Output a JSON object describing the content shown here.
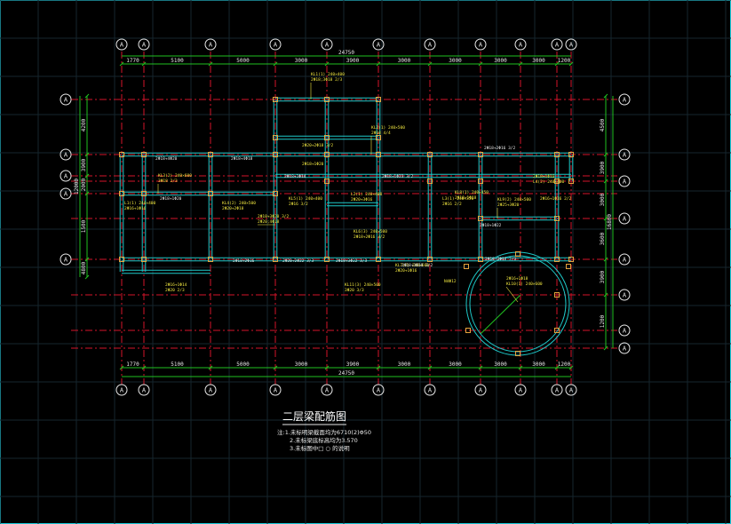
{
  "drawing": {
    "title": "二层梁配筋图",
    "notes": [
      "注:1.未标明梁截面均为6710(2)Φ50",
      "2.未标梁底标高均为3.570",
      "3.未标图中□ ○ 的说明"
    ]
  },
  "axes": {
    "vertical_labels": [
      "A",
      "A",
      "A",
      "A",
      "A",
      "A",
      "A",
      "A",
      "A",
      "A",
      "A"
    ],
    "horizontal_labels_left": [
      "A",
      "A",
      "A",
      "A",
      "A"
    ],
    "horizontal_labels_right": [
      "A",
      "A",
      "A",
      "A",
      "A",
      "A",
      "A",
      "A"
    ]
  },
  "dimensions": {
    "top_overall": "24750",
    "top_segments": [
      "1770",
      "5100",
      "5000",
      "3000",
      "3900",
      "3000",
      "3000",
      "3000",
      "3000",
      "1200"
    ],
    "bottom_overall": "24750",
    "bottom_segments": [
      "1770",
      "5100",
      "5000",
      "3000",
      "3900",
      "3000",
      "3000",
      "3000",
      "3000",
      "1200"
    ],
    "left_segments": [
      "4200",
      "3900",
      "2000",
      "1500",
      "4800",
      "1800"
    ],
    "left_overall": "12000",
    "right_segments": [
      "4500",
      "3900",
      "3000",
      "3600",
      "3900",
      "1200"
    ],
    "right_overall": "16800"
  },
  "beam_labels": [
    "KL1(1) 240×400",
    "2Φ18;3Φ18 2/3",
    "KL2(1) 240×500",
    "2Φ18 4/4",
    "2Φ20+2Φ18 3/2",
    "2Φ18+1Φ20",
    "KL3(2) 240×600",
    "3Φ18 2/3",
    "L1(1) 240×400",
    "2Φ16+1Φ16",
    "KL4(2) 240×500",
    "2Φ20+2Φ18",
    "2Φ18+3Φ20 3/2",
    "2Φ20;4Φ18",
    "KL5(1) 240×400",
    "2Φ16 3/2",
    "L2(1) 240×400",
    "2Φ20+3Φ16",
    "KL6(3) 240×500",
    "2Φ18+2Φ16 3/2",
    "KL7(2) 240×600",
    "2Φ20+1Φ16",
    "L3(1) 240×350",
    "2Φ16 2/2",
    "KL8(1) 240×450",
    "2Φ18+1Φ18",
    "KL9(2) 240×500",
    "2Φ25+3Φ20",
    "2Φ18+1Φ16",
    "L4(2) 240×400",
    "2Φ16+1Φ18",
    "KL10(1) 240×600",
    "2Φ16+1Φ14",
    "2Φ20 2/3",
    "N4Φ12",
    "KL11(3) 240×500",
    "3Φ20 3/3",
    "2Φ16+1Φ16 2/2"
  ],
  "colors": {
    "background": "#000000",
    "grid": "#16262e",
    "axis": "#d4142a",
    "beam": "#1ec8c8",
    "column": "#e6a23c",
    "dimension": "#20c020",
    "annotation": "#f0e640",
    "text": "#e8e8e8",
    "frame": "#19c8d8"
  }
}
